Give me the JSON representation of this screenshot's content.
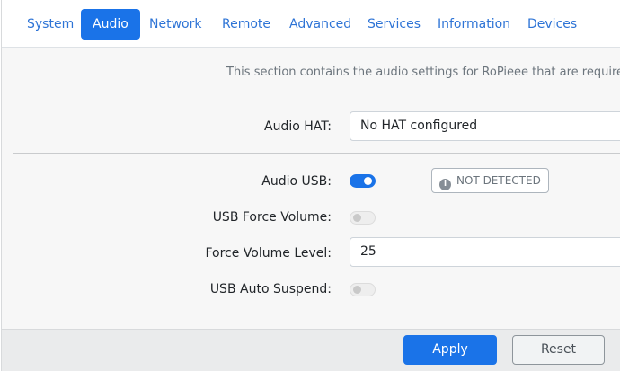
{
  "tabs": [
    {
      "label": "System",
      "active": false
    },
    {
      "label": "Audio",
      "active": true
    },
    {
      "label": "Network",
      "active": false
    },
    {
      "label": "Remote",
      "active": false
    },
    {
      "label": "Advanced",
      "active": false
    },
    {
      "label": "Services",
      "active": false
    },
    {
      "label": "Information",
      "active": false
    },
    {
      "label": "Devices",
      "active": false
    }
  ],
  "intro": "This section contains the audio settings for RoPieee that are required for",
  "audio_hat": {
    "label": "Audio HAT:",
    "value": "No HAT configured"
  },
  "audio_usb": {
    "label": "Audio USB:",
    "enabled": true,
    "badge": {
      "icon": "info-circle-icon",
      "glyph": "i",
      "text": "NOT DETECTED"
    }
  },
  "usb_force_volume": {
    "label": "USB Force Volume:",
    "enabled": false
  },
  "force_volume_level": {
    "label": "Force Volume Level:",
    "value": "25"
  },
  "usb_auto_suspend": {
    "label": "USB Auto Suspend:",
    "enabled": false
  },
  "footer": {
    "apply_label": "Apply",
    "reset_label": "Reset"
  },
  "colors": {
    "accent": "#1a73e8",
    "tab_link": "#2e74d6",
    "content_bg": "#f7f7f7",
    "footer_bg": "#eaebec"
  }
}
